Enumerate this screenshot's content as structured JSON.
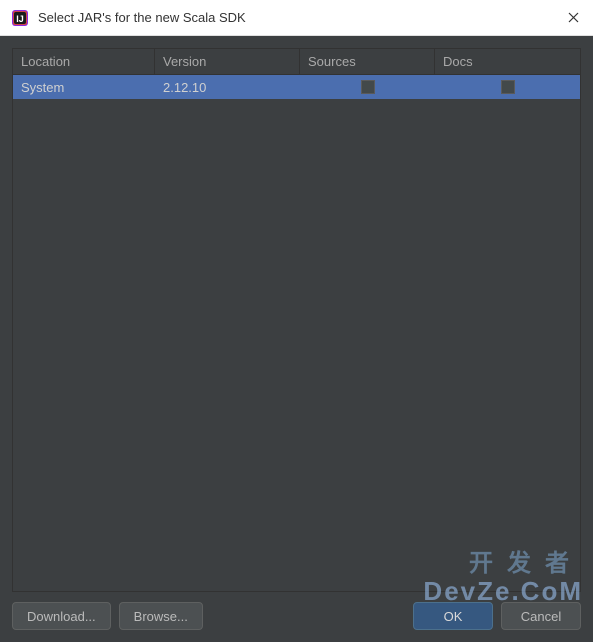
{
  "window": {
    "title": "Select JAR's for the new Scala SDK"
  },
  "table": {
    "headers": {
      "location": "Location",
      "version": "Version",
      "sources": "Sources",
      "docs": "Docs"
    },
    "rows": [
      {
        "location": "System",
        "version": "2.12.10",
        "sources_checked": false,
        "docs_checked": false
      }
    ]
  },
  "buttons": {
    "download": "Download...",
    "browse": "Browse...",
    "ok": "OK",
    "cancel": "Cancel"
  },
  "watermark": {
    "line1": "开发者",
    "line2": "DevZe.CoM"
  }
}
